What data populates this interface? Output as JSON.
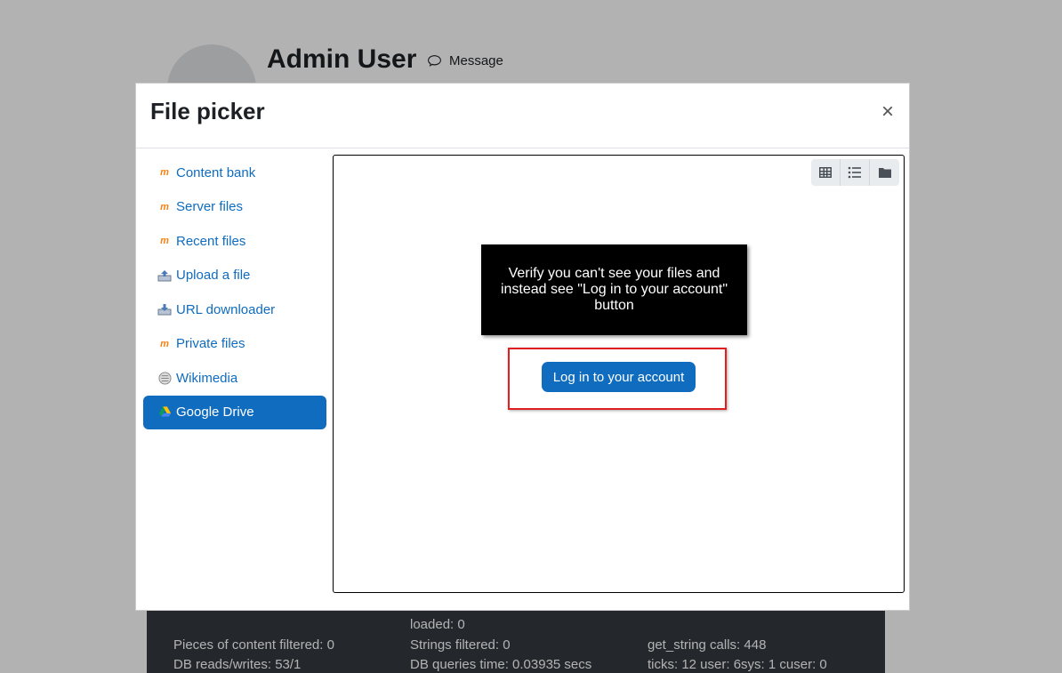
{
  "profile": {
    "name": "Admin User",
    "message_label": "Message"
  },
  "footer": {
    "loaded": "loaded: 0",
    "content_filtered": "Pieces of content filtered: 0",
    "strings_filtered": "Strings filtered: 0",
    "get_string_calls": "get_string calls: 448",
    "db_reads_writes": "DB reads/writes: 53/1",
    "db_queries_time": "DB queries time: 0.03935 secs",
    "ticks": "ticks: 12 user: 6sys: 1 cuser: 0"
  },
  "modal": {
    "title": "File picker",
    "close_label": "×"
  },
  "repositories": [
    {
      "label": "Content bank",
      "icon": "moodle-icon"
    },
    {
      "label": "Server files",
      "icon": "moodle-icon"
    },
    {
      "label": "Recent files",
      "icon": "moodle-icon"
    },
    {
      "label": "Upload a file",
      "icon": "upload-icon"
    },
    {
      "label": "URL downloader",
      "icon": "download-icon"
    },
    {
      "label": "Private files",
      "icon": "moodle-icon"
    },
    {
      "label": "Wikimedia",
      "icon": "wikimedia-icon"
    },
    {
      "label": "Google Drive",
      "icon": "google-drive-icon",
      "active": true
    }
  ],
  "view_modes": [
    "grid-icon",
    "list-icon",
    "folder-icon"
  ],
  "instruction": "Verify you can't see your files and instead see \"Log in to your account\" button",
  "login_button": "Log in to your account",
  "colors": {
    "accent": "#0f6cbf",
    "highlight": "#e02020",
    "footer_bg": "#343a40"
  }
}
